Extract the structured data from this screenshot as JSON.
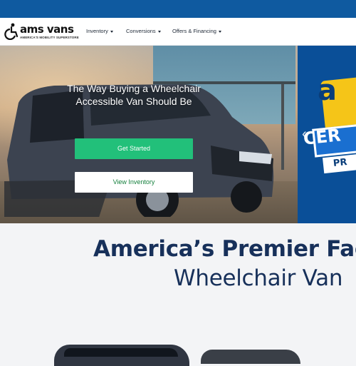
{
  "header": {
    "logo_text": "ams vans",
    "logo_tagline": "AMERICA'S MOBILITY SUPERSTORE",
    "nav": [
      {
        "label": "Inventory"
      },
      {
        "label": "Conversions"
      },
      {
        "label": "Offers & Financing"
      }
    ]
  },
  "hero": {
    "title": "The Way Buying a Wheelchair Accessible Van Should Be",
    "primary_button": "Get Started",
    "secondary_button": "View Inventory",
    "badge_letter": "a",
    "badge_ribbon": "CER",
    "badge_sub": "PR",
    "prev_arrow": "‹"
  },
  "main": {
    "headline_line1": "America’s Premier Fac",
    "headline_line2": "Wheelchair Van"
  },
  "colors": {
    "topbar": "#0f5aa0",
    "green_button": "#22c07a",
    "headline": "#17305a",
    "badge_blue": "#0a4f98",
    "badge_yellow": "#f5c518"
  }
}
